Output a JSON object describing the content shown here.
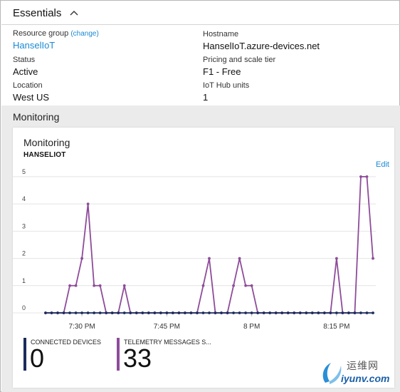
{
  "essentials": {
    "title": "Essentials",
    "resource_group_label": "Resource group",
    "resource_group_change": "(change)",
    "resource_group_value": "HanselIoT",
    "status_label": "Status",
    "status_value": "Active",
    "location_label": "Location",
    "location_value": "West US",
    "hostname_label": "Hostname",
    "hostname_value": "HanselIoT.azure-devices.net",
    "tier_label": "Pricing and scale tier",
    "tier_value": "F1 - Free",
    "units_label": "IoT Hub units",
    "units_value": "1"
  },
  "monitoring": {
    "section_title": "Monitoring",
    "tile_title": "Monitoring",
    "tile_subtitle": "HANSELIOT",
    "edit_label": "Edit"
  },
  "metrics": [
    {
      "name": "CONNECTED DEVICES",
      "value": "0",
      "color": "#1b2b5b"
    },
    {
      "name": "TELEMETRY MESSAGES S...",
      "value": "33",
      "color": "#8e4c9a"
    }
  ],
  "colors": {
    "accent_link": "#1a8ad4",
    "series_telemetry": "#8e4c9a",
    "series_devices": "#1b2b5b"
  },
  "watermark": {
    "cn": "运维网",
    "en": "iyunv.com"
  },
  "chart_data": {
    "type": "line",
    "x_tick_labels": [
      "7:30 PM",
      "7:45 PM",
      "8 PM",
      "8:15 PM"
    ],
    "x_tick_indices": [
      6,
      20,
      34,
      48
    ],
    "ylim": [
      0,
      5
    ],
    "y_ticks": [
      0,
      1,
      2,
      3,
      4,
      5
    ],
    "grid": true,
    "series": [
      {
        "values": [
          0,
          0,
          0,
          0,
          1,
          1,
          2,
          4,
          1,
          1,
          0,
          0,
          0,
          1,
          0,
          0,
          0,
          0,
          0,
          0,
          0,
          0,
          0,
          0,
          0,
          0,
          1,
          2,
          0,
          0,
          0,
          1,
          2,
          1,
          1,
          0,
          0,
          0,
          0,
          0,
          0,
          0,
          0,
          0,
          0,
          0,
          0,
          0,
          2,
          0,
          0,
          0,
          5,
          5,
          2
        ]
      },
      {
        "values": [
          0,
          0,
          0,
          0,
          0,
          0,
          0,
          0,
          0,
          0,
          0,
          0,
          0,
          0,
          0,
          0,
          0,
          0,
          0,
          0,
          0,
          0,
          0,
          0,
          0,
          0,
          0,
          0,
          0,
          0,
          0,
          0,
          0,
          0,
          0,
          0,
          0,
          0,
          0,
          0,
          0,
          0,
          0,
          0,
          0,
          0,
          0,
          0,
          0,
          0,
          0,
          0,
          0,
          0,
          0
        ]
      }
    ]
  }
}
